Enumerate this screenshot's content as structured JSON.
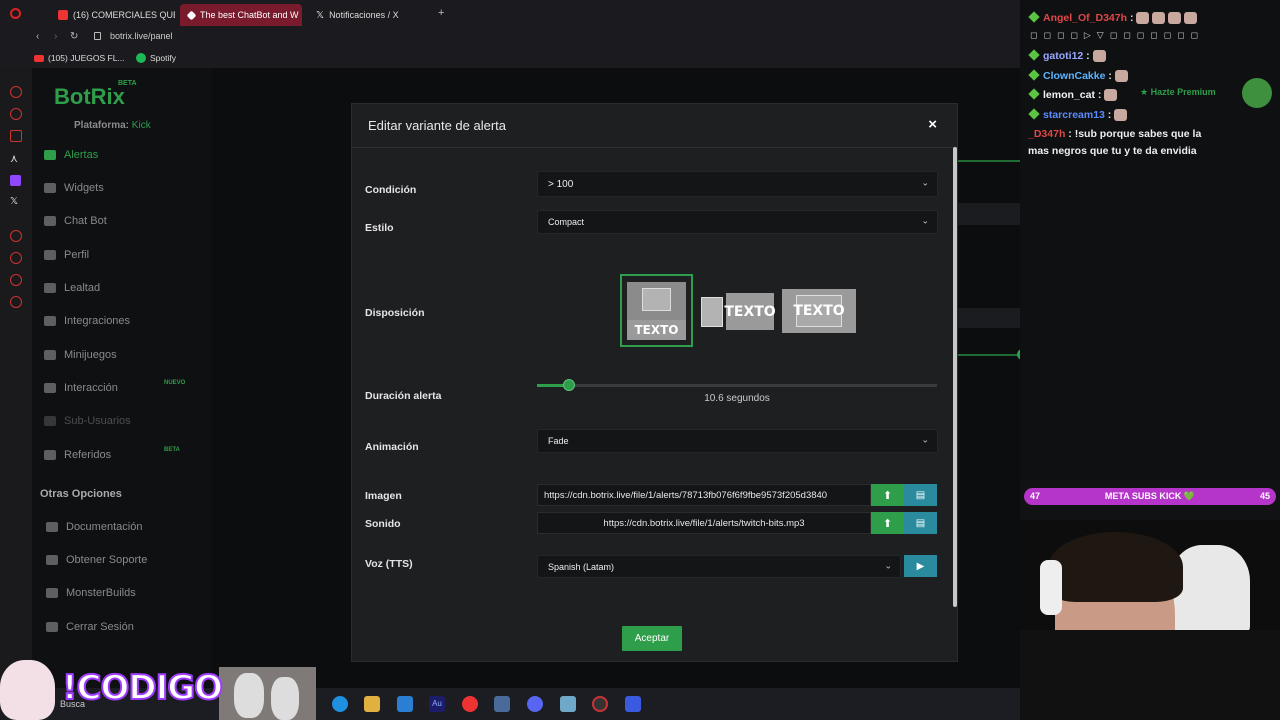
{
  "browser": {
    "tabs": [
      {
        "label": "(16) COMERCIALES QUE",
        "active": false
      },
      {
        "label": "The best ChatBot and W",
        "active": true
      },
      {
        "label": "Notificaciones / X",
        "active": false
      }
    ],
    "url": "botrix.live/panel",
    "bookmarks": [
      "(105) JUEGOS FL...",
      "Spotify"
    ]
  },
  "app": {
    "logo": "BotRix",
    "logo_badge": "BETA",
    "platform_label": "Plataforma:",
    "platform_value": "Kick",
    "nav": [
      {
        "label": "Alertas",
        "active": true
      },
      {
        "label": "Widgets"
      },
      {
        "label": "Chat Bot"
      },
      {
        "label": "Perfil"
      },
      {
        "label": "Lealtad"
      },
      {
        "label": "Integraciones"
      },
      {
        "label": "Minijuegos"
      },
      {
        "label": "Interacción",
        "badge": "NUEVO"
      },
      {
        "label": "Sub-Usuarios"
      },
      {
        "label": "Referidos",
        "badge": "BETA"
      }
    ],
    "other_title": "Otras Opciones",
    "other": [
      {
        "label": "Documentación"
      },
      {
        "label": "Obtener Soporte"
      },
      {
        "label": "MonsterBuilds"
      },
      {
        "label": "Cerrar Sesión"
      }
    ]
  },
  "modal": {
    "title": "Editar variante de alerta",
    "close": "×",
    "condition_label": "Condición",
    "condition_value": "> 100",
    "style_label": "Estilo",
    "style_value": "Compact",
    "layout_label": "Disposición",
    "layout_text": "TEXTO",
    "layout_selected": 0,
    "duration_label": "Duración alerta",
    "duration_value": "10.6 segundos",
    "duration_fraction": 0.08,
    "animation_label": "Animación",
    "animation_value": "Fade",
    "image_label": "Imagen",
    "image_url": "https://cdn.botrix.live/file/1/alerts/78713fb076f6f9fbe9573f205d3840",
    "sound_label": "Sonido",
    "sound_url": "https://cdn.botrix.live/file/1/alerts/twitch-bits.mp3",
    "voice_label": "Voz (TTS)",
    "voice_value": "Spanish (Latam)",
    "accept_label": "Aceptar"
  },
  "chat": {
    "lines": [
      {
        "user": "Angel_Of_D347h",
        "color": "#e04848",
        "msg": ""
      },
      {
        "user": "gatoti12",
        "color": "#9aa7ff",
        "msg": ""
      },
      {
        "user": "ClownCakke",
        "color": "#5cb4ff",
        "msg": ""
      },
      {
        "user": "lemon_cat",
        "color": "#f2f2f2",
        "msg": ""
      },
      {
        "user": "starcream13",
        "color": "#5c8cff",
        "msg": ""
      },
      {
        "user": "_D347h",
        "color": "#e04848",
        "msg": "!sub porque sabes que la"
      },
      {
        "user": "",
        "color": "#eee",
        "msg": "mas negros que tu y te da envidia"
      }
    ],
    "premium": "Hazte Premium"
  },
  "meta_bar": {
    "left": "47",
    "label": "META SUBS KICK 💚",
    "right": "45"
  },
  "overlay": {
    "codigo": "!CODIGO"
  },
  "taskbar": {
    "search": "Busca"
  }
}
